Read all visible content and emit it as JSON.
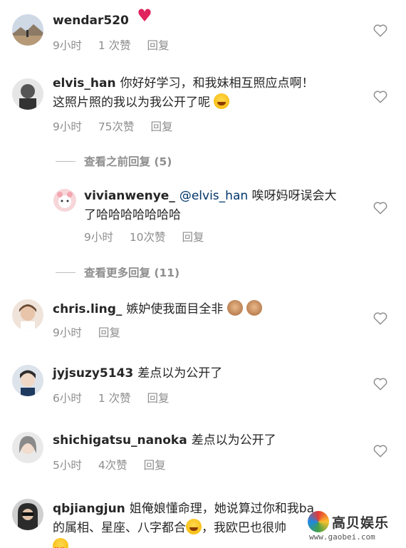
{
  "comments": [
    {
      "username": "wendar520",
      "text": "",
      "emoji": "broken-heart",
      "time": "9小时",
      "likes": "1 次赞",
      "reply": "回复",
      "avatar_color": "#9db0c8"
    },
    {
      "username": "elvis_han",
      "text": "你好好学习，和我妹相互照应点啊！",
      "text2": "这照片照的我以为我公开了呢",
      "emoji": "laughing",
      "time": "9小时",
      "likes": "75次赞",
      "reply": "回复",
      "avatar_color": "#4a4a4a"
    },
    {
      "username": "chris.ling_",
      "text": "嫉妒使我面目全非",
      "emoji": "see-no-evil-monkey",
      "time": "9小时",
      "reply": "回复",
      "avatar_color": "#d9b7a4"
    },
    {
      "username": "jyjsuzy5143",
      "text": "差点以为公开了",
      "time": "6小时",
      "likes": "1 次赞",
      "reply": "回复",
      "avatar_color": "#6a7280"
    },
    {
      "username": "shichigatsu_nanoka",
      "text": "差点以为公开了",
      "time": "5小时",
      "likes": "4次赞",
      "reply": "回复",
      "avatar_color": "#b8b8b8"
    },
    {
      "username": "qbjiangjun",
      "text": "姐俺娘懂命理，她说算过你和我",
      "text_partial": "ba",
      "text2": "的属相、星座、八字都合",
      "text3": "，我欧巴也很帅",
      "emoji": "heart-eyes",
      "avatar_color": "#3a3a3a"
    }
  ],
  "replies": {
    "view_previous": "查看之前回复 (5)",
    "view_more": "查看更多回复 (11)",
    "reply": {
      "username": "vivianwenye_",
      "mention": "@elvis_han",
      "text": "唉呀妈呀误会大",
      "text2": "了哈哈哈哈哈哈哈",
      "time": "9小时",
      "likes": "10次赞",
      "reply": "回复",
      "avatar_color": "#f2c3c8"
    }
  },
  "watermark": {
    "text": "高贝娱乐",
    "url": "www.gaobei.com"
  }
}
